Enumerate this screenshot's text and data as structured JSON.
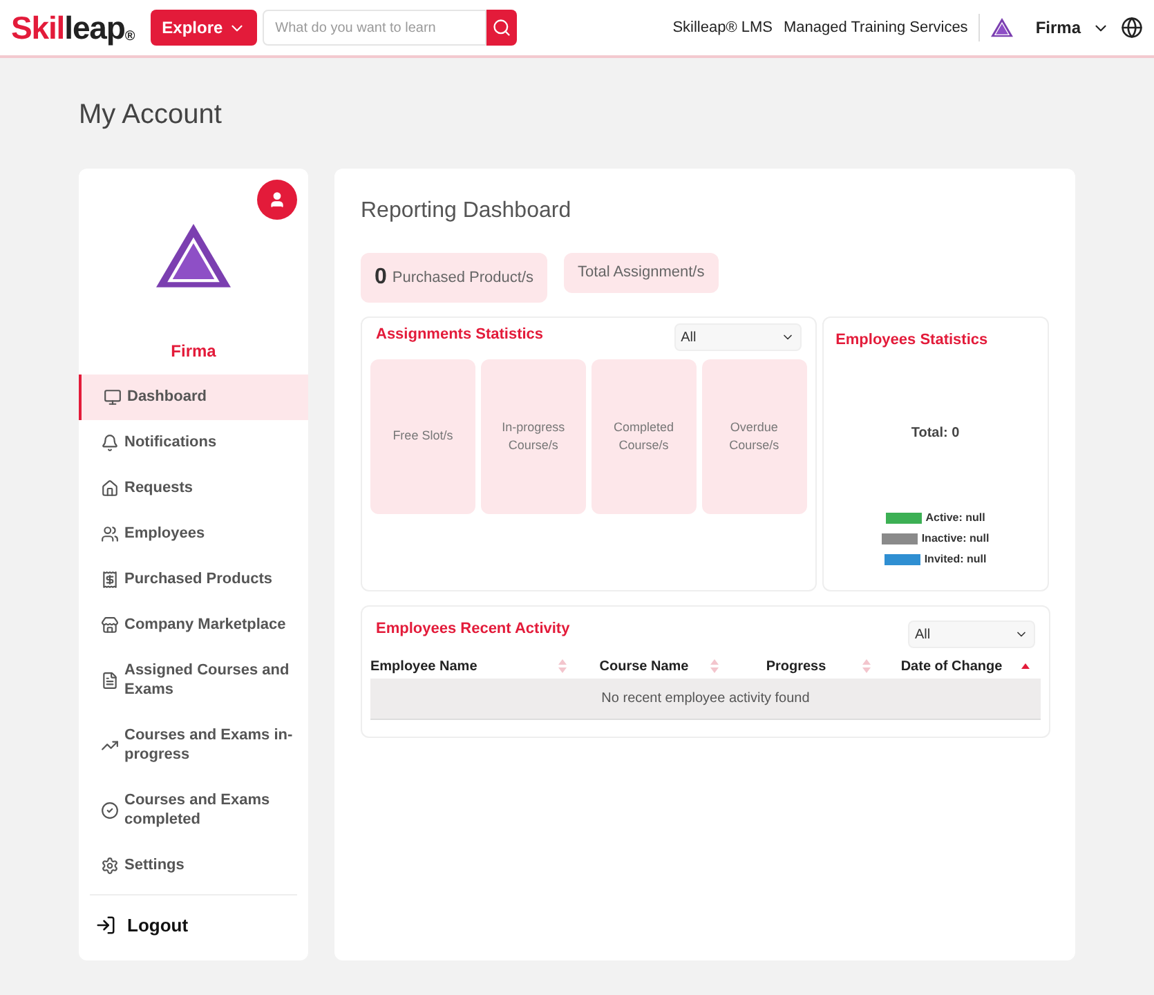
{
  "header": {
    "logo": [
      "Skil",
      "leap",
      "®"
    ],
    "explore": "Explore",
    "search_placeholder": "What do you want to learn",
    "links": [
      "Skilleap® LMS",
      "Managed Training Services"
    ],
    "user": "Firma"
  },
  "page_title": "My Account",
  "sidebar": {
    "company": "Firma",
    "items": [
      {
        "label": "Dashboard",
        "selected": true
      },
      {
        "label": "Notifications",
        "selected": false
      },
      {
        "label": "Requests",
        "selected": false
      },
      {
        "label": "Employees",
        "selected": false
      },
      {
        "label": "Purchased Products",
        "selected": false
      },
      {
        "label": "Company Marketplace",
        "selected": false
      },
      {
        "label": "Assigned Courses and Exams",
        "selected": false
      },
      {
        "label": "Courses and Exams in-progress",
        "selected": false
      },
      {
        "label": "Courses and Exams completed",
        "selected": false
      },
      {
        "label": "Settings",
        "selected": false
      }
    ],
    "logout": "Logout"
  },
  "dashboard": {
    "title": "Reporting Dashboard",
    "summary": [
      {
        "count": "0",
        "label": "Purchased Product/s"
      },
      {
        "label": "Total Assignment/s"
      }
    ],
    "assignments": {
      "title": "Assignments Statistics",
      "filter": "All",
      "tiles": [
        "Free Slot/s",
        "In-progress Course/s",
        "Completed Course/s",
        "Overdue Course/s"
      ]
    },
    "employees": {
      "title": "Employees Statistics",
      "total": "Total: 0",
      "legend": [
        {
          "label": "Active: null",
          "color": "#3cb054"
        },
        {
          "label": "Inactive: null",
          "color": "#8a8a8a"
        },
        {
          "label": "Invited: null",
          "color": "#2f8fd2"
        }
      ]
    },
    "activity": {
      "title": "Employees Recent Activity",
      "filter": "All",
      "columns": [
        {
          "label": "Employee Name",
          "sorted": false
        },
        {
          "label": "Course Name",
          "sorted": false
        },
        {
          "label": "Progress",
          "sorted": false
        },
        {
          "label": "Date of Change",
          "sorted": true
        }
      ],
      "empty": "No recent employee activity found"
    }
  }
}
